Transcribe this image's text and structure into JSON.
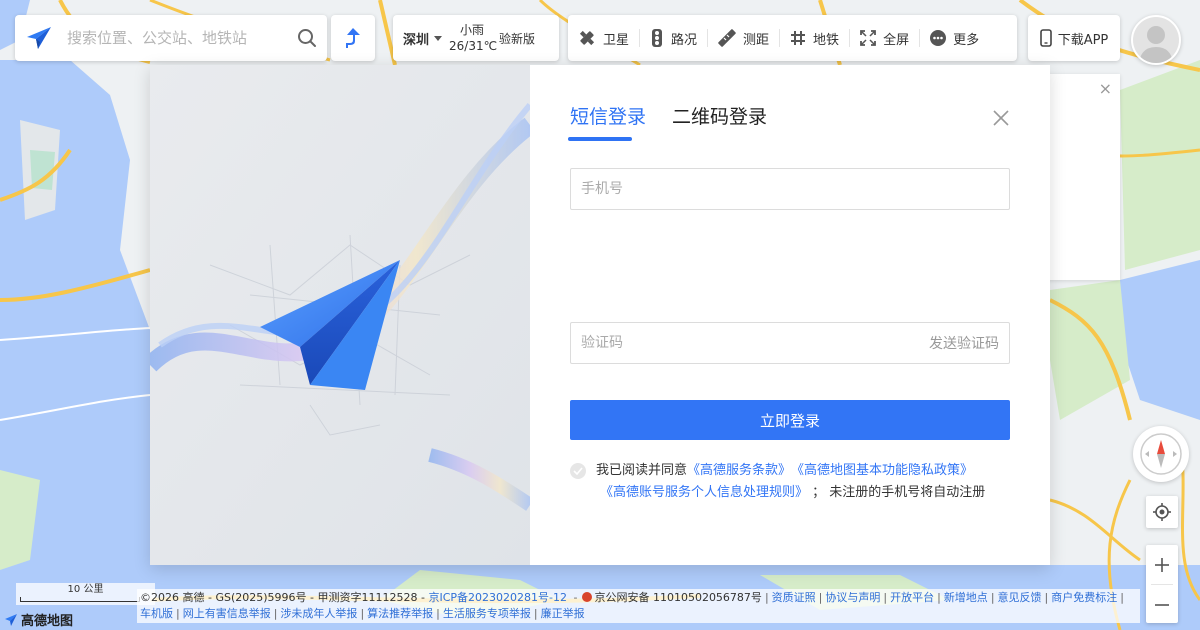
{
  "search": {
    "placeholder": "搜索位置、公交站、地铁站"
  },
  "city_weather": {
    "city": "深圳",
    "weather": "小雨",
    "temperature": "26/31℃",
    "new_version": "验新版"
  },
  "toolbar": {
    "satellite": "卫星",
    "traffic": "路况",
    "measure": "测距",
    "subway": "地铁",
    "fullscreen": "全屏",
    "more": "更多"
  },
  "download": {
    "label": "下载APP"
  },
  "login": {
    "tab_sms": "短信登录",
    "tab_qr": "二维码登录",
    "phone_placeholder": "手机号",
    "code_placeholder": "验证码",
    "send_code": "发送验证码",
    "submit": "立即登录",
    "agree_prefix": "我已阅读并同意",
    "terms_service": "《高德服务条款》",
    "terms_privacy": "《高德地图基本功能隐私政策》",
    "terms_personal": "《高德账号服务个人信息处理规则》",
    "agree_suffix": "；  未注册的手机号将自动注册"
  },
  "map": {
    "scale_label": "10 公里",
    "brand": "高德地图"
  },
  "footer": {
    "copyright": "©2026 高德 - GS(2025)5996号 - 甲测资字11112528 -",
    "icp": "京ICP备2023020281号-12",
    "police": "京公网安备 11010502056787号",
    "links": [
      "资质证照",
      "协议与声明",
      "开放平台",
      "新增地点",
      "意见反馈",
      "商户免费标注",
      "车机版",
      "网上有害信息举报",
      "涉未成年人举报",
      "算法推荐举报",
      "生活服务专项举报",
      "廉正举报"
    ]
  },
  "colors": {
    "accent": "#3275f5",
    "water": "#aecbfa",
    "land": "#eef1f3",
    "road": "#f7c64a"
  }
}
